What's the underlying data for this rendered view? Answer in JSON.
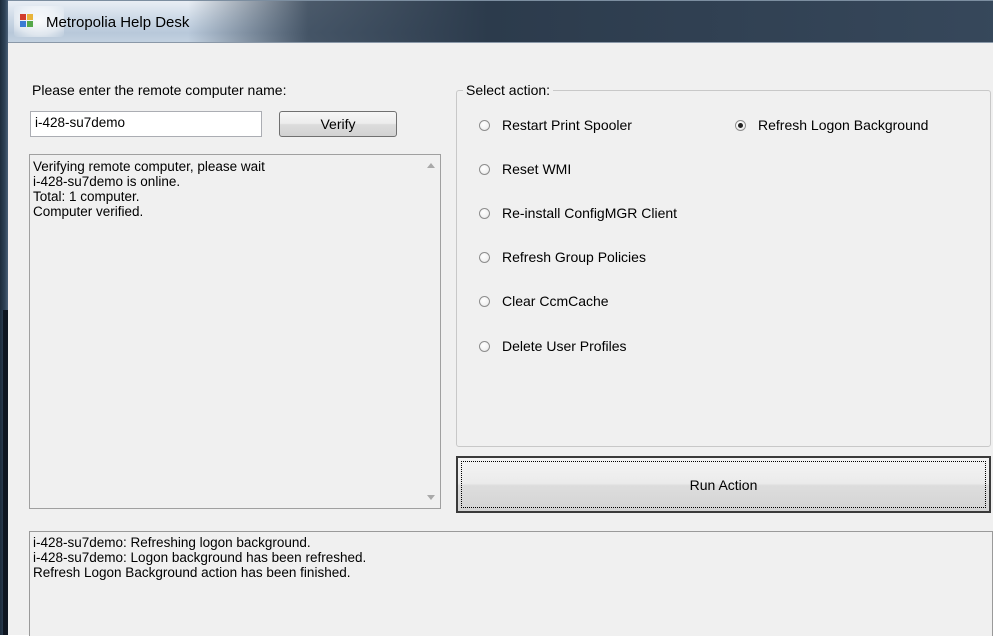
{
  "window": {
    "title": "Metropolia Help Desk",
    "icon": "app-window-icon"
  },
  "computer": {
    "prompt_label": "Please enter the remote computer name:",
    "name_value": "i-428-su7demo",
    "verify_label": "Verify"
  },
  "verify_log": {
    "lines": [
      "Verifying remote computer, please wait",
      "i-428-su7demo is online.",
      "Total: 1 computer.",
      "Computer verified."
    ]
  },
  "actions": {
    "group_label": "Select action:",
    "options": [
      {
        "label": "Restart Print Spooler",
        "checked": false
      },
      {
        "label": "Refresh Logon Background",
        "checked": true
      },
      {
        "label": "Reset WMI",
        "checked": false
      },
      {
        "label": "Re-install ConfigMGR Client",
        "checked": false
      },
      {
        "label": "Refresh Group Policies",
        "checked": false
      },
      {
        "label": "Clear CcmCache",
        "checked": false
      },
      {
        "label": "Delete User Profiles",
        "checked": false
      }
    ],
    "run_label": "Run Action"
  },
  "output_log": {
    "lines": [
      "i-428-su7demo: Refreshing logon background.",
      "i-428-su7demo: Logon background has been refreshed.",
      "Refresh Logon Background action has been finished."
    ]
  },
  "colors": {
    "window_bg": "#f0f0f0",
    "frame_dark": "#2c3b4c",
    "border": "#a0a0a0"
  }
}
